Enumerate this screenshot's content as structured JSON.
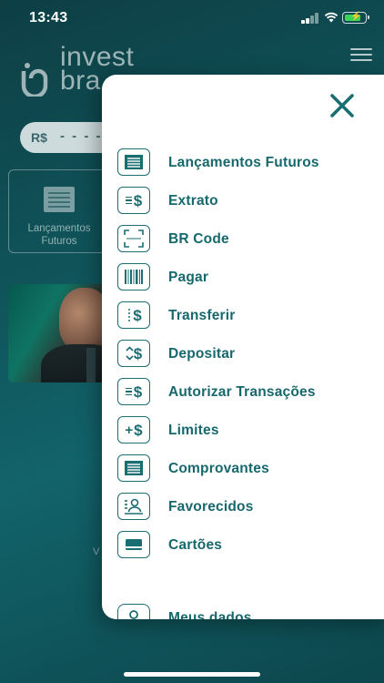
{
  "status_bar": {
    "time": "13:43"
  },
  "background": {
    "logo": {
      "line1": "invest",
      "line2": "bra"
    },
    "balance": {
      "currency": "R$",
      "masked_value": "- - - -"
    },
    "card": {
      "label": "Lançamentos Futuros"
    },
    "footer_fragment": "V"
  },
  "drawer": {
    "items": [
      {
        "label": "Lançamentos Futuros",
        "icon": "statement-list-icon"
      },
      {
        "label": "Extrato",
        "icon": "lines-dollar-icon"
      },
      {
        "label": "BR Code",
        "icon": "qr-scan-icon"
      },
      {
        "label": "Pagar",
        "icon": "barcode-icon"
      },
      {
        "label": "Transferir",
        "icon": "transfer-dollar-icon"
      },
      {
        "label": "Depositar",
        "icon": "deposit-dollar-icon"
      },
      {
        "label": "Autorizar Transações",
        "icon": "authorize-dollar-icon"
      },
      {
        "label": "Limites",
        "icon": "plus-dollar-icon"
      },
      {
        "label": "Comprovantes",
        "icon": "receipt-icon"
      },
      {
        "label": "Favorecidos",
        "icon": "contacts-icon"
      },
      {
        "label": "Cartões",
        "icon": "card-icon"
      },
      {
        "label": "Meus dados",
        "icon": "user-icon"
      }
    ]
  },
  "colors": {
    "accent": "#17686d",
    "background": "#0f5157",
    "drawer": "#ffffff"
  }
}
